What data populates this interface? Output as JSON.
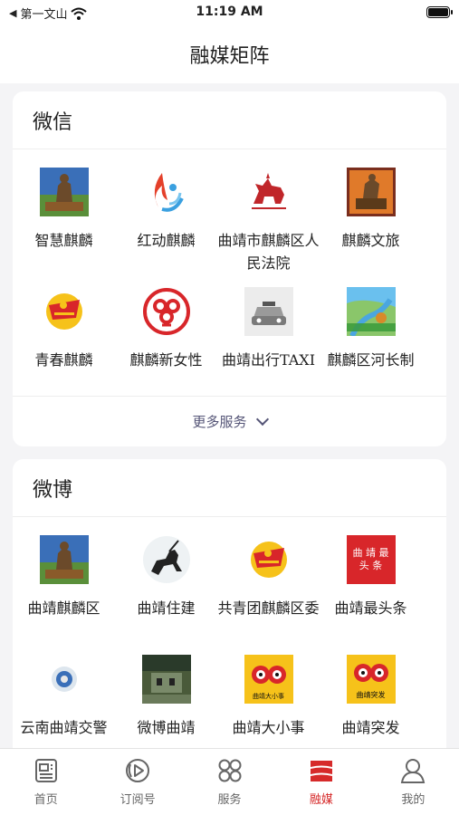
{
  "status_bar": {
    "carrier": "第一文山",
    "time": "11:19 AM"
  },
  "nav": {
    "title": "融媒矩阵"
  },
  "wechat": {
    "title": "微信",
    "items": [
      {
        "name": "智慧麒麟",
        "icon": "statue-logo"
      },
      {
        "name": "红动麒麟",
        "icon": "red-flame-logo"
      },
      {
        "name": "曲靖市麒麟区人民法院",
        "icon": "court-qilin-logo"
      },
      {
        "name": "麒麟文旅",
        "icon": "culture-tourism-logo"
      },
      {
        "name": "青春麒麟",
        "icon": "youth-league-logo"
      },
      {
        "name": "麒麟新女性",
        "icon": "womens-federation-logo"
      },
      {
        "name": "曲靖出行TAXI",
        "icon": "taxi-logo"
      },
      {
        "name": "麒麟区河长制",
        "icon": "river-chief-logo"
      }
    ],
    "more_label": "更多服务"
  },
  "weibo": {
    "title": "微博",
    "items": [
      {
        "name": "曲靖麒麟区",
        "icon": "statue-logo"
      },
      {
        "name": "曲靖住建",
        "icon": "horse-rider-logo"
      },
      {
        "name": "共青团麒麟区委",
        "icon": "youth-league-logo"
      },
      {
        "name": "曲靖最头条",
        "icon": "top-news-logo",
        "logo_text_1": "曲 靖 最",
        "logo_text_2": "头 条"
      },
      {
        "name": "云南曲靖交警",
        "icon": "police-badge-logo"
      },
      {
        "name": "微博曲靖",
        "icon": "city-photo-logo"
      },
      {
        "name": "曲靖大小事",
        "icon": "cartoon-eyes-logo",
        "logo_text": "曲靖大小事"
      },
      {
        "name": "曲靖突发",
        "icon": "cartoon-eyes-logo-2",
        "logo_text": "曲靖突发"
      }
    ]
  },
  "tabbar": {
    "items": [
      {
        "label": "首页",
        "icon": "newspaper-icon"
      },
      {
        "label": "订阅号",
        "icon": "subscribe-icon"
      },
      {
        "label": "服务",
        "icon": "grid-icon"
      },
      {
        "label": "融媒",
        "icon": "media-icon"
      },
      {
        "label": "我的",
        "icon": "user-icon"
      }
    ],
    "active_index": 3
  },
  "colors": {
    "accent": "#d62a2a",
    "court_red": "#c0262a",
    "tab_inactive": "#666666",
    "more_text": "#555577"
  }
}
